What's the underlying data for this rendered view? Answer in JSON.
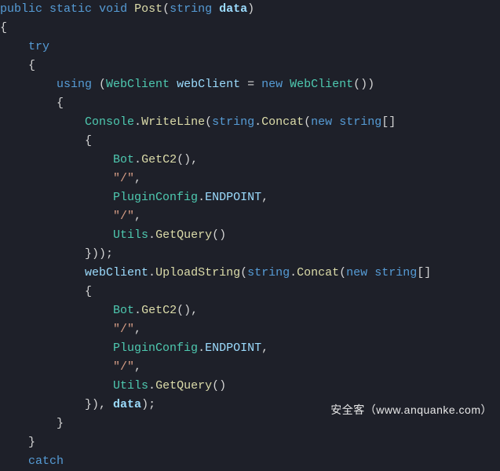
{
  "code": {
    "sig": {
      "public": "public",
      "static": "static",
      "void": "void",
      "fn": "Post",
      "paren_open": "(",
      "string": "string",
      "param": "data",
      "paren_close": ")"
    },
    "brace_open_main": "{",
    "try": "try",
    "brace_open_try": "{",
    "using_kw": "using",
    "using_open": " (",
    "webclient_type": "WebClient",
    "webclient_var": "webClient",
    "eq": " = ",
    "new": "new",
    "webclient_type2": "WebClient",
    "ctor_call": "())",
    "brace_open_using": "{",
    "console": "Console",
    "dot": ".",
    "writeline": "WriteLine",
    "call_open": "(",
    "string_kw": "string",
    "concat": "Concat",
    "arr_open": "(",
    "new2": "new",
    "string_kw2": "string",
    "array_suffix": "[]",
    "arr_brace_open": "{",
    "bot": "Bot",
    "getc2": "GetC2",
    "call_empty": "()",
    "comma": ",",
    "slash": "\"/\"",
    "pluginconfig": "PluginConfig",
    "endpoint": "ENDPOINT",
    "utils": "Utils",
    "getquery": "GetQuery",
    "arr_brace_close": "}))",
    "semi": ";",
    "uploadstring": "UploadString",
    "arr_brace_close2": "}), ",
    "data_use": "data",
    "close_paren_semi": ");",
    "brace_close_using": "}",
    "brace_close_try": "}",
    "catch": "catch"
  },
  "watermark": {
    "brand": "安全客",
    "paren_open": "（",
    "url": "www.anquanke.com",
    "paren_close": "）"
  }
}
